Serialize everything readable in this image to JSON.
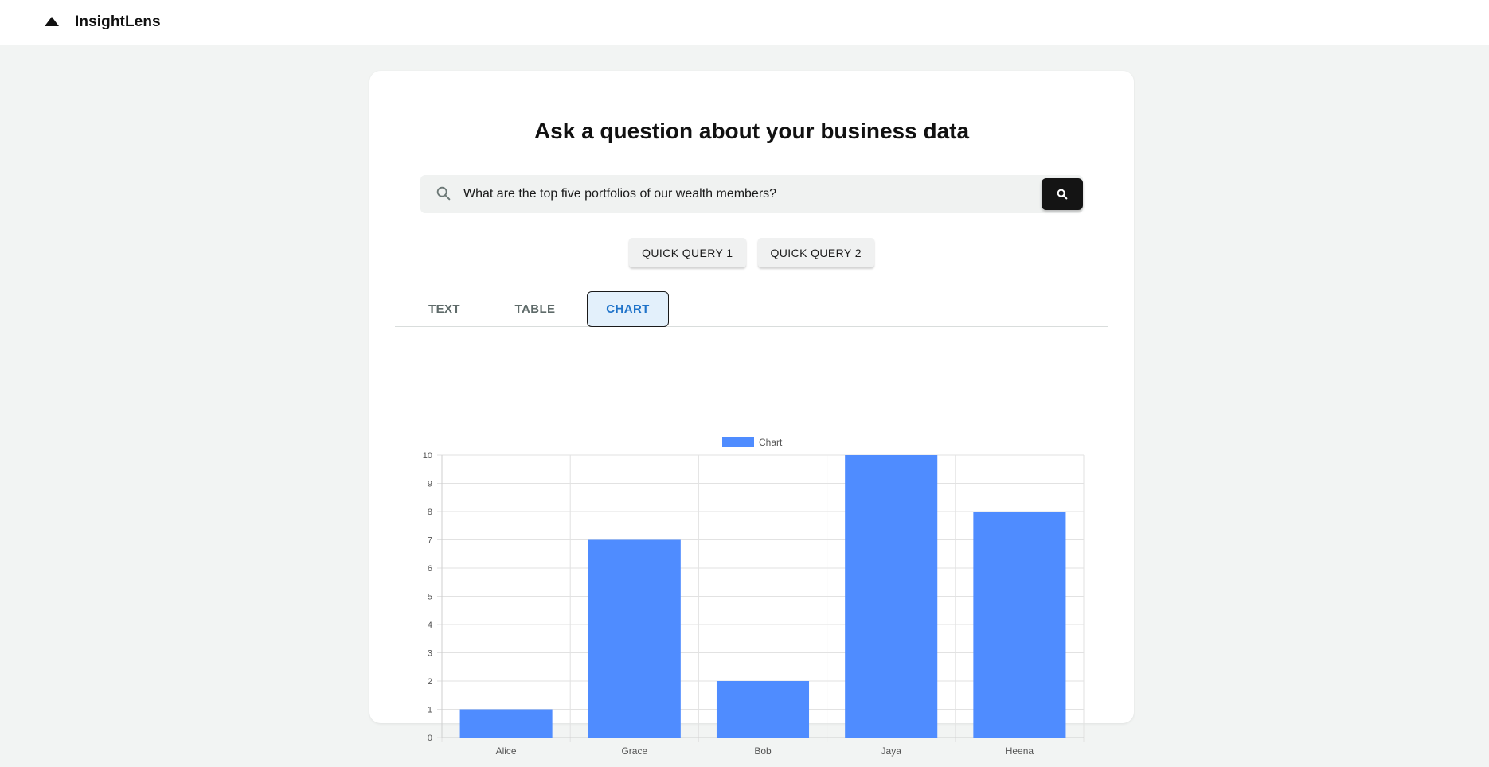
{
  "app": {
    "brand": "InsightLens",
    "logo_icon": "triangle-logo-icon"
  },
  "main": {
    "heading": "Ask a question about your business data",
    "search": {
      "value": "What are the top five portfolios of our wealth members?",
      "icon": "search-icon",
      "button_icon": "search-icon"
    },
    "quick_queries": [
      "QUICK QUERY 1",
      "QUICK QUERY 2"
    ],
    "tabs": [
      {
        "label": "TEXT",
        "active": false
      },
      {
        "label": "TABLE",
        "active": false
      },
      {
        "label": "CHART",
        "active": true
      }
    ]
  },
  "colors": {
    "bar": "#4f8cff",
    "accent": "#1f73c9",
    "dark_button": "#141414"
  },
  "chart_data": {
    "type": "bar",
    "categories": [
      "Alice",
      "Grace",
      "Bob",
      "Jaya",
      "Heena"
    ],
    "series": [
      {
        "name": "Chart",
        "values": [
          1,
          7,
          2,
          10,
          8
        ]
      }
    ],
    "ylim": [
      0,
      10
    ],
    "yticks": [
      0,
      1,
      2,
      3,
      4,
      5,
      6,
      7,
      8,
      9,
      10
    ],
    "grid": true,
    "legend": "top-center"
  }
}
